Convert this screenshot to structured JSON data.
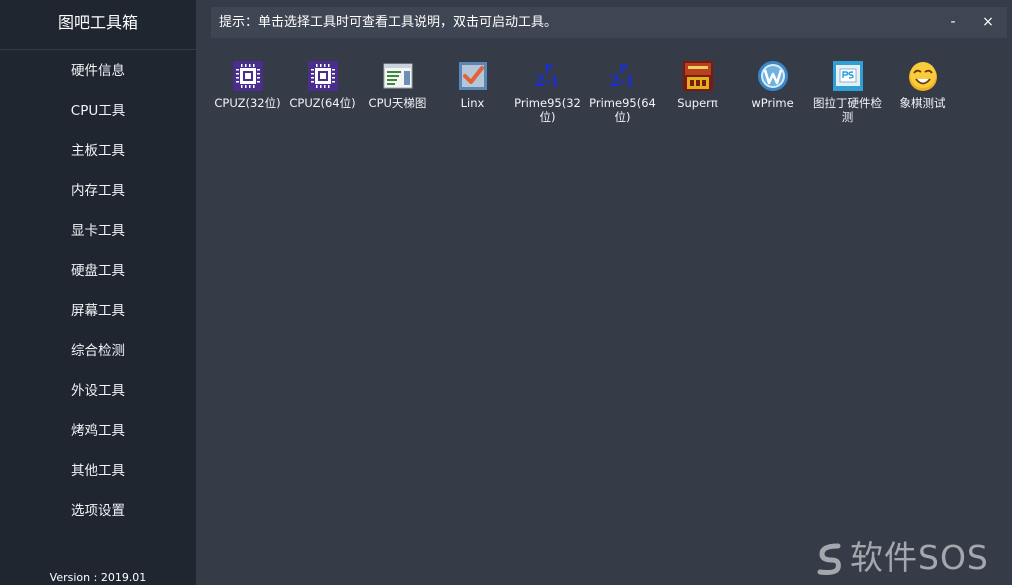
{
  "sidebar": {
    "title": "图吧工具箱",
    "items": [
      {
        "label": "硬件信息"
      },
      {
        "label": "CPU工具"
      },
      {
        "label": "主板工具"
      },
      {
        "label": "内存工具"
      },
      {
        "label": "显卡工具"
      },
      {
        "label": "硬盘工具"
      },
      {
        "label": "屏幕工具"
      },
      {
        "label": "综合检测"
      },
      {
        "label": "外设工具"
      },
      {
        "label": "烤鸡工具"
      },
      {
        "label": "其他工具"
      },
      {
        "label": "选项设置"
      }
    ],
    "version": "Version : 2019.01"
  },
  "hint_bar": {
    "text": "提示：单击选择工具时可查看工具说明，双击可启动工具。",
    "minimize": "-",
    "close": "×"
  },
  "tools": [
    {
      "label": "CPUZ(32位)",
      "icon": "cpuz-chip-icon"
    },
    {
      "label": "CPUZ(64位)",
      "icon": "cpuz-chip-icon"
    },
    {
      "label": "CPU天梯图",
      "icon": "chart-window-icon"
    },
    {
      "label": "Linx",
      "icon": "checkbox-icon"
    },
    {
      "label": "Prime95(32位)",
      "icon": "prime95-icon"
    },
    {
      "label": "Prime95(64位)",
      "icon": "prime95-icon"
    },
    {
      "label": "Superπ",
      "icon": "superpi-icon"
    },
    {
      "label": "wPrime",
      "icon": "wprime-icon"
    },
    {
      "label": "图拉丁硬件检测",
      "icon": "pss-icon"
    },
    {
      "label": "象棋测试",
      "icon": "smiley-icon"
    }
  ],
  "watermark": {
    "text": "软件SOS"
  },
  "colors": {
    "sidebar_bg": "#1f2630",
    "main_bg": "#353c48",
    "hint_bg": "#3f4653"
  }
}
